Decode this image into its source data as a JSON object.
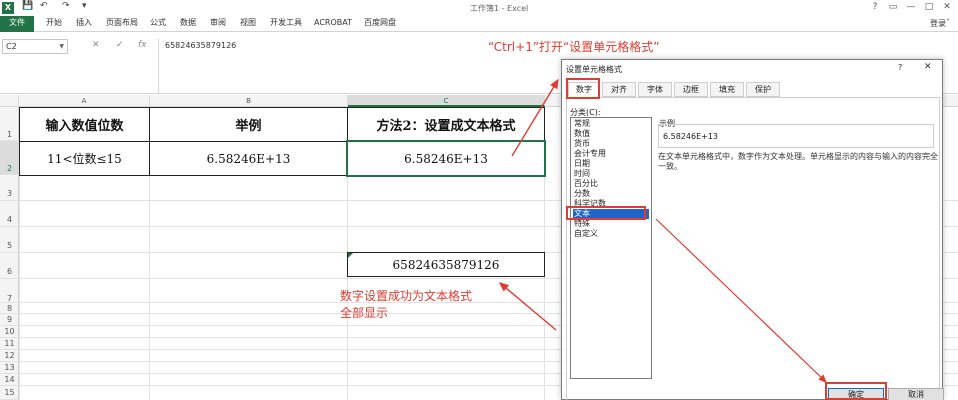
{
  "titlebar": {
    "logo": "X",
    "qat_icons": [
      "save-icon",
      "undo-icon",
      "redo-icon",
      "customize-icon"
    ],
    "title": "工作簿1 - Excel",
    "win": [
      "?",
      "▭",
      "—",
      "□",
      "✕"
    ]
  },
  "ribbon": {
    "tabs": [
      "文件",
      "开始",
      "插入",
      "页面布局",
      "公式",
      "数据",
      "审阅",
      "视图",
      "开发工具",
      "ACROBAT",
      "百度网盘"
    ],
    "login": "登录"
  },
  "formulabar": {
    "namebox": "C2",
    "cancel": "✕",
    "enter": "✓",
    "fx": "fx",
    "formula": "65824635879126"
  },
  "columns": [
    "A",
    "B",
    "C"
  ],
  "rows": [
    "1",
    "2",
    "3",
    "4",
    "5",
    "6",
    "7",
    "8",
    "9",
    "10",
    "11",
    "12",
    "13",
    "14",
    "15"
  ],
  "table": {
    "header": [
      "输入数值位数",
      "举例",
      "方法2：设置成文本格式"
    ],
    "row": [
      "11<位数≤15",
      "6.58246E+13",
      "6.58246E+13"
    ]
  },
  "c6_value": "65824635879126",
  "annotations": {
    "top": "“Ctrl+1”打开“设置单元格格式”",
    "mid_line1": "数字设置成功为文本格式",
    "mid_line2": "全部显示"
  },
  "dialog": {
    "title": "设置单元格格式",
    "help": "?",
    "close": "✕",
    "tabs": [
      "数字",
      "对齐",
      "字体",
      "边框",
      "填充",
      "保护"
    ],
    "category_label": "分类(C):",
    "categories": [
      "常规",
      "数值",
      "货币",
      "会计专用",
      "日期",
      "时间",
      "百分比",
      "分数",
      "科学记数",
      "文本",
      "特殊",
      "自定义"
    ],
    "selected_category": "文本",
    "sample_label": "示例",
    "sample_value": "6.58246E+13",
    "description": "在文本单元格格式中，数字作为文本处理。单元格显示的内容与输入的内容完全一致。",
    "ok": "确定",
    "cancel": "取消"
  },
  "colors": {
    "excel_green": "#217346",
    "annotation_red": "#e03c31",
    "selection_blue": "#1e66c8"
  }
}
